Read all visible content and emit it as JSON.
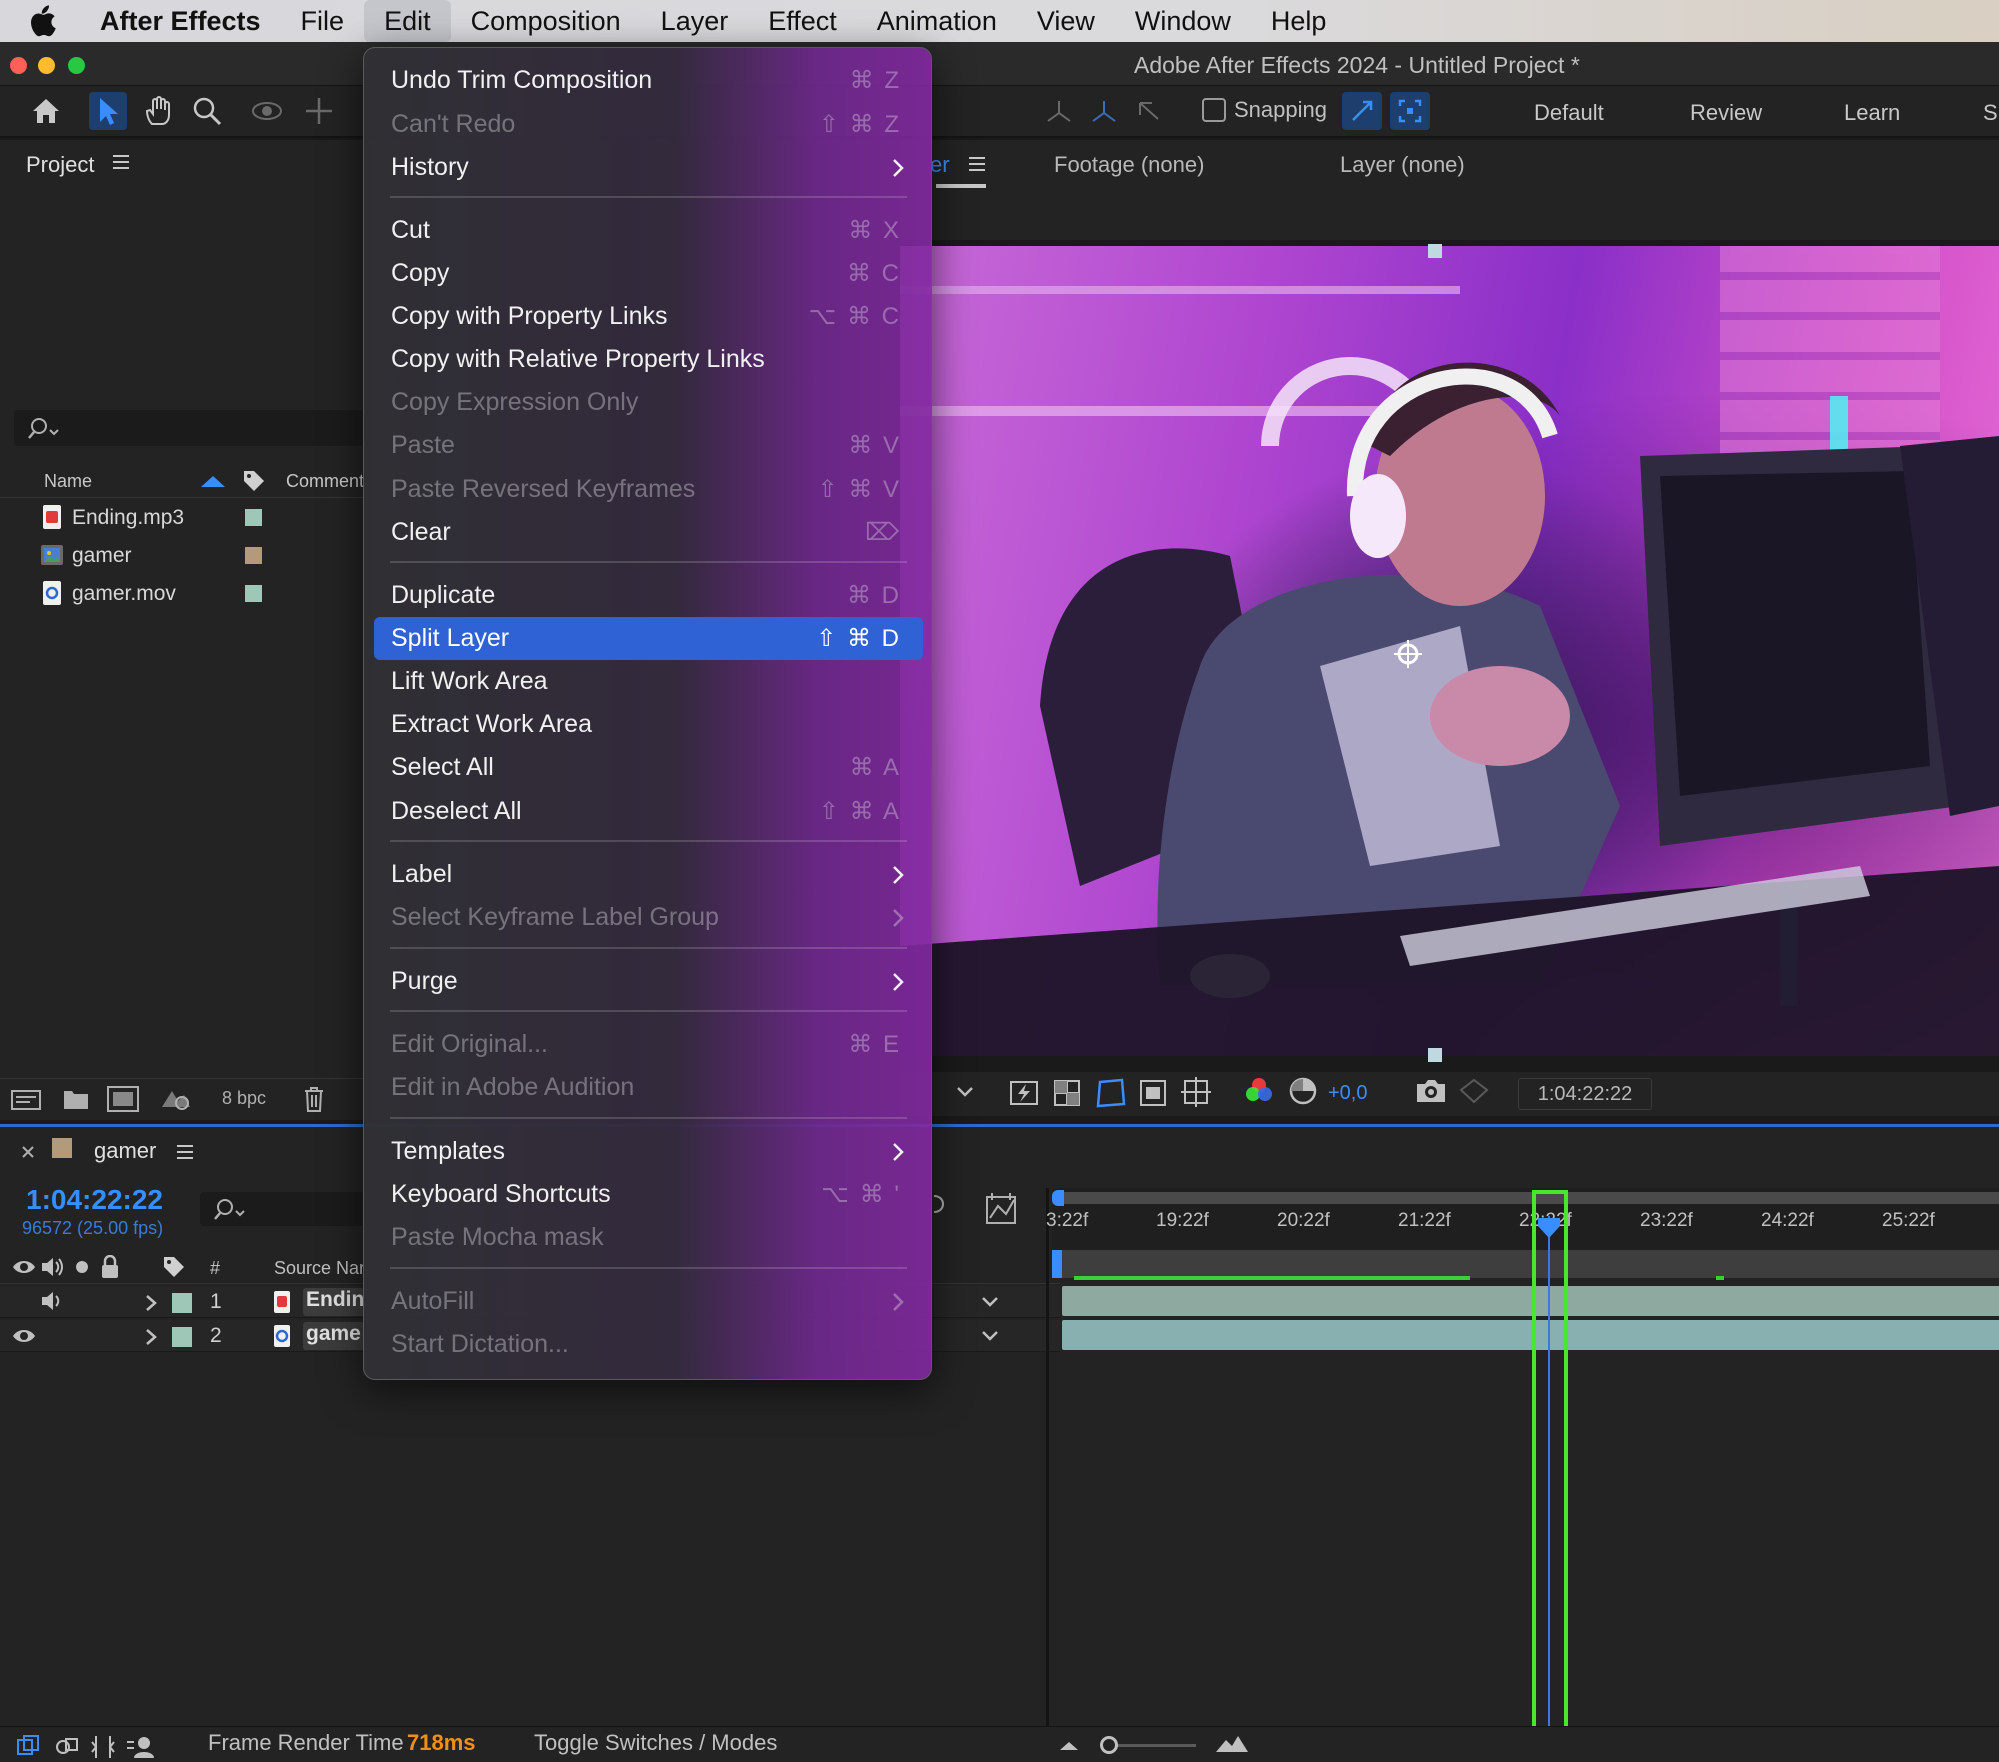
{
  "menubar": {
    "app_name": "After Effects",
    "items": [
      "File",
      "Edit",
      "Composition",
      "Layer",
      "Effect",
      "Animation",
      "View",
      "Window",
      "Help"
    ]
  },
  "window": {
    "title": "Adobe After Effects 2024 - Untitled Project *"
  },
  "toolbar": {
    "snapping_label": "Snapping",
    "workspaces": [
      "Default",
      "Review",
      "Learn",
      "Sr"
    ]
  },
  "project": {
    "title": "Project",
    "col_name": "Name",
    "col_comment": "Comment",
    "items": [
      {
        "name": "Ending.mp3",
        "type": "audio",
        "label_color": "#9ec7b8"
      },
      {
        "name": "gamer",
        "type": "composition",
        "label_color": "#b39a7a"
      },
      {
        "name": "gamer.mov",
        "type": "video",
        "label_color": "#9ec7b8"
      }
    ],
    "bit_depth": "8 bpc"
  },
  "viewer": {
    "tab_partial": "er",
    "footage_tab": "Footage (none)",
    "layer_tab": "Layer (none)",
    "exposure": "+0,0",
    "current_time": "1:04:22:22"
  },
  "timeline": {
    "comp_name": "gamer",
    "current_time": "1:04:22:22",
    "frame_info": "96572 (25.00 fps)",
    "col_hash": "#",
    "col_source": "Source Nar",
    "layers": [
      {
        "num": "1",
        "name": "Endin",
        "label_color": "#9ec7b8"
      },
      {
        "num": "2",
        "name": "game",
        "label_color": "#9ec7b8"
      }
    ],
    "ticks": [
      "3:22f",
      "19:22f",
      "20:22f",
      "21:22f",
      "22:22f",
      "23:22f",
      "24:22f",
      "25:22f"
    ],
    "render_label": "Frame Render Time",
    "render_value": "718ms",
    "toggle_label": "Toggle Switches / Modes"
  },
  "edit_menu": {
    "items": [
      {
        "label": "Undo Trim Composition",
        "shortcut": "⌘ Z",
        "disabled": false
      },
      {
        "label": "Can't Redo",
        "shortcut": "⇧ ⌘ Z",
        "disabled": true
      },
      {
        "label": "History",
        "submenu": true,
        "disabled": false
      },
      {
        "label": "Cut",
        "shortcut": "⌘ X",
        "disabled": false
      },
      {
        "label": "Copy",
        "shortcut": "⌘ C",
        "disabled": false
      },
      {
        "label": "Copy with Property Links",
        "shortcut": "⌥ ⌘ C",
        "disabled": false
      },
      {
        "label": "Copy with Relative Property Links",
        "disabled": false
      },
      {
        "label": "Copy Expression Only",
        "disabled": true
      },
      {
        "label": "Paste",
        "shortcut": "⌘ V",
        "disabled": true
      },
      {
        "label": "Paste Reversed Keyframes",
        "shortcut": "⇧ ⌘ V",
        "disabled": true
      },
      {
        "label": "Clear",
        "shortcut": "⌦",
        "disabled": false
      },
      {
        "label": "Duplicate",
        "shortcut": "⌘ D",
        "disabled": false
      },
      {
        "label": "Split Layer",
        "shortcut": "⇧ ⌘ D",
        "disabled": false,
        "highlighted": true
      },
      {
        "label": "Lift Work Area",
        "disabled": false
      },
      {
        "label": "Extract Work Area",
        "disabled": false
      },
      {
        "label": "Select All",
        "shortcut": "⌘ A",
        "disabled": false
      },
      {
        "label": "Deselect All",
        "shortcut": "⇧ ⌘ A",
        "disabled": false
      },
      {
        "label": "Label",
        "submenu": true,
        "disabled": false
      },
      {
        "label": "Select Keyframe Label Group",
        "submenu": true,
        "disabled": true
      },
      {
        "label": "Purge",
        "submenu": true,
        "disabled": false
      },
      {
        "label": "Edit Original...",
        "shortcut": "⌘ E",
        "disabled": true
      },
      {
        "label": "Edit in Adobe Audition",
        "disabled": true
      },
      {
        "label": "Templates",
        "submenu": true,
        "disabled": false
      },
      {
        "label": "Keyboard Shortcuts",
        "shortcut": "⌥ ⌘ '",
        "disabled": false
      },
      {
        "label": "Paste Mocha mask",
        "disabled": true
      },
      {
        "label": "AutoFill",
        "submenu": true,
        "disabled": true
      },
      {
        "label": "Start Dictation...",
        "disabled": true
      }
    ]
  }
}
